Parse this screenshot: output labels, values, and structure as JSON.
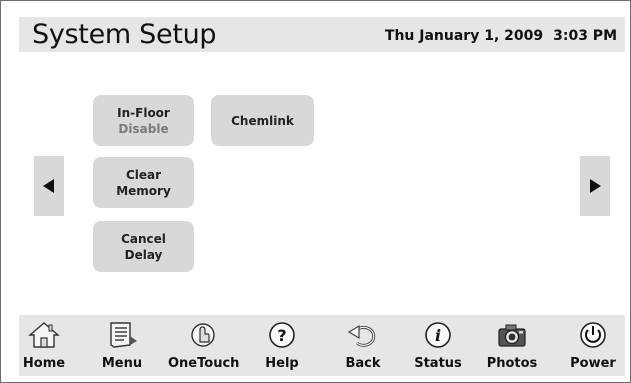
{
  "header": {
    "title": "System Setup",
    "date": "Thu January 1, 2009",
    "time": "3:03 PM"
  },
  "buttons": {
    "infloor": {
      "line1": "In-Floor",
      "line2": "Disable"
    },
    "chemlink": {
      "label": "Chemlink"
    },
    "clear_memory": {
      "line1": "Clear",
      "line2": "Memory"
    },
    "cancel_delay": {
      "line1": "Cancel",
      "line2": "Delay"
    }
  },
  "arrows": {
    "left": "left-arrow-icon",
    "right": "right-arrow-icon"
  },
  "nav": [
    {
      "label": "Home",
      "icon": "home-icon"
    },
    {
      "label": "Menu",
      "icon": "menu-icon"
    },
    {
      "label": "OneTouch",
      "icon": "onetouch-icon"
    },
    {
      "label": "Help",
      "icon": "help-icon"
    },
    {
      "label": "Back",
      "icon": "back-icon"
    },
    {
      "label": "Status",
      "icon": "status-icon"
    },
    {
      "label": "Photos",
      "icon": "camera-icon"
    },
    {
      "label": "Power",
      "icon": "power-icon"
    }
  ],
  "colors": {
    "panel": "#e6e6e6",
    "button": "#d8d8d8",
    "text": "#111111"
  }
}
